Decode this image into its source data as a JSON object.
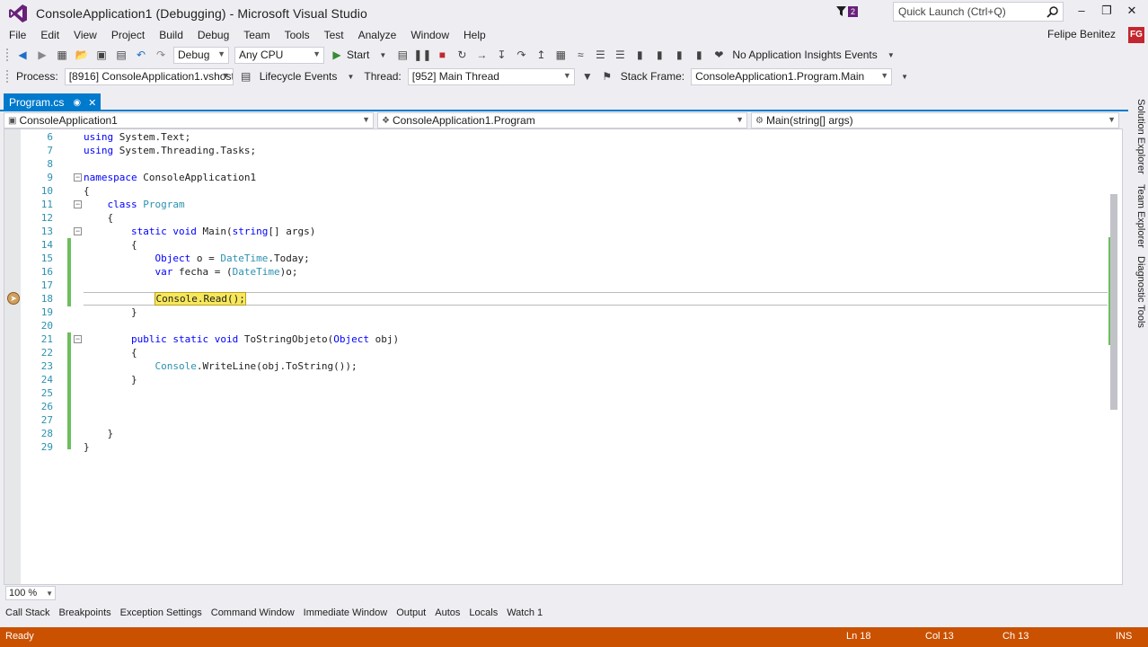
{
  "window": {
    "title": "ConsoleApplication1 (Debugging) - Microsoft Visual Studio",
    "notification_count": "2",
    "quick_launch_placeholder": "Quick Launch (Ctrl+Q)",
    "user_name": "Felipe Benitez",
    "user_initials": "FG"
  },
  "menu": [
    "File",
    "Edit",
    "View",
    "Project",
    "Build",
    "Debug",
    "Team",
    "Tools",
    "Test",
    "Analyze",
    "Window",
    "Help"
  ],
  "toolbar": {
    "config": "Debug",
    "platform": "Any CPU",
    "start_label": "Start",
    "insights_label": "No Application Insights Events"
  },
  "debug_location": {
    "process_label": "Process:",
    "process_value": "[8916] ConsoleApplication1.vshost",
    "lifecycle_label": "Lifecycle Events",
    "thread_label": "Thread:",
    "thread_value": "[952] Main Thread",
    "stack_frame_label": "Stack Frame:",
    "stack_frame_value": "ConsoleApplication1.Program.Main"
  },
  "document_tab": {
    "name": "Program.cs"
  },
  "navigation": {
    "project": "ConsoleApplication1",
    "type": "ConsoleApplication1.Program",
    "member": "Main(string[] args)"
  },
  "editor": {
    "line_numbers": [
      "6",
      "7",
      "8",
      "9",
      "10",
      "11",
      "12",
      "13",
      "14",
      "15",
      "16",
      "17",
      "18",
      "19",
      "20",
      "21",
      "22",
      "23",
      "24",
      "25",
      "26",
      "27",
      "28",
      "29"
    ],
    "lines": [
      "using System.Text;",
      "using System.Threading.Tasks;",
      "",
      "namespace ConsoleApplication1",
      "{",
      "    class Program",
      "    {",
      "        static void Main(string[] args)",
      "        {",
      "            Object o = DateTime.Today;",
      "            var fecha = (DateTime)o;",
      "",
      "            Console.Read();",
      "        }",
      "",
      "        public static void ToStringObjeto(Object obj)",
      "        {",
      "            Console.WriteLine(obj.ToString());",
      "        }",
      "",
      "",
      "",
      "    }",
      "}"
    ],
    "current_statement": "Console.Read();",
    "zoom": "100 %"
  },
  "side_panels": [
    "Solution Explorer",
    "Team Explorer",
    "Diagnostic Tools"
  ],
  "bottom_tabs": [
    "Call Stack",
    "Breakpoints",
    "Exception Settings",
    "Command Window",
    "Immediate Window",
    "Output",
    "Autos",
    "Locals",
    "Watch 1"
  ],
  "status": {
    "message": "Ready",
    "line": "Ln 18",
    "col": "Col 13",
    "ch": "Ch 13",
    "mode": "INS"
  },
  "colors": {
    "accent": "#007acc",
    "status_bar": "#ca5100",
    "keyword": "#0000ff",
    "type": "#2b91af",
    "current_statement": "#f7e75c"
  }
}
